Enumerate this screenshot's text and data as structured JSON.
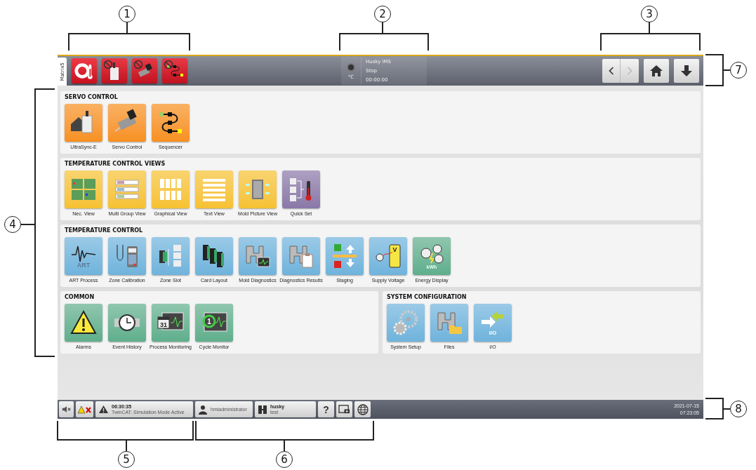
{
  "top_bar": {
    "tab": {
      "label": "Matrix5",
      "selected": true
    },
    "module_buttons": [
      {
        "disabled": false
      },
      {
        "disabled": true
      },
      {
        "disabled": true
      },
      {
        "disabled": true
      }
    ],
    "status": {
      "unit": "°C",
      "lines": [
        "Husky IMS",
        "Stop",
        "00:00:00"
      ]
    },
    "nav": {
      "back": {
        "disabled": false
      },
      "forward": {
        "disabled": true
      }
    }
  },
  "rows": [
    {
      "sections": [
        {
          "title": "SERVO CONTROL",
          "tiles": [
            {
              "label": "UltraSync-E",
              "color": "#f7901e"
            },
            {
              "label": "Servo Control",
              "color": "#f7901e"
            },
            {
              "label": "Sequencer",
              "color": "#f7901e"
            }
          ]
        }
      ]
    },
    {
      "sections": [
        {
          "title": "TEMPERATURE CONTROL VIEWS",
          "tiles": [
            {
              "label": "Nec. View",
              "color": "#f6c130"
            },
            {
              "label": "Multi Group View",
              "color": "#f6c130"
            },
            {
              "label": "Graphical View",
              "color": "#f6c130"
            },
            {
              "label": "Text View",
              "color": "#f6c130"
            },
            {
              "label": "Mold Picture View",
              "color": "#f6c130"
            },
            {
              "label": "Quick Set",
              "color": "#8a78a8"
            }
          ]
        }
      ]
    },
    {
      "sections": [
        {
          "title": "TEMPERATURE CONTROL",
          "tiles": [
            {
              "label": "ART Process",
              "color": "#6fb3dc",
              "icon_text": "ART"
            },
            {
              "label": "Zone Calibration",
              "color": "#6fb3dc"
            },
            {
              "label": "Zone Slot",
              "color": "#6fb3dc"
            },
            {
              "label": "Card Layout",
              "color": "#6fb3dc"
            },
            {
              "label": "Mold Diagnostics",
              "color": "#6fb3dc"
            },
            {
              "label": "Diagnostics Results",
              "color": "#6fb3dc"
            },
            {
              "label": "Staging",
              "color": "#6fb3dc"
            },
            {
              "label": "Supply Voltage",
              "color": "#6fb3dc",
              "icon_text": "V"
            },
            {
              "label": "Energy Display",
              "color": "#5fae8c",
              "icon_text": "kWh"
            }
          ]
        }
      ]
    },
    {
      "sections": [
        {
          "title": "COMMON",
          "tiles": [
            {
              "label": "Alarms",
              "color": "#5fae8c"
            },
            {
              "label": "Event History",
              "color": "#5fae8c"
            },
            {
              "label": "Process Monitoring",
              "color": "#5fae8c",
              "icon_text": "31"
            },
            {
              "label": "Cycle Monitor",
              "color": "#5fae8c",
              "icon_text": "1"
            }
          ]
        },
        {
          "title": "SYSTEM CONFIGURATION",
          "tiles": [
            {
              "label": "System Setup",
              "color": "#6fb3dc"
            },
            {
              "label": "Files",
              "color": "#6fb3dc"
            },
            {
              "label": "I/O",
              "color": "#6fb3dc",
              "icon_text": "I/O"
            }
          ]
        }
      ]
    }
  ],
  "status_bar": {
    "message": {
      "time": "06:30:35",
      "text": "TwinCAT: Simulation Mode Active"
    },
    "user": "hmiadministrator",
    "machine": {
      "name": "husky",
      "mode": "test"
    },
    "help": "?",
    "date": "2021-07-15",
    "time": "07:23:05"
  },
  "callouts": [
    {
      "number": "1"
    },
    {
      "number": "2"
    },
    {
      "number": "3"
    },
    {
      "number": "4"
    },
    {
      "number": "5"
    },
    {
      "number": "6"
    },
    {
      "number": "7"
    },
    {
      "number": "8"
    }
  ]
}
